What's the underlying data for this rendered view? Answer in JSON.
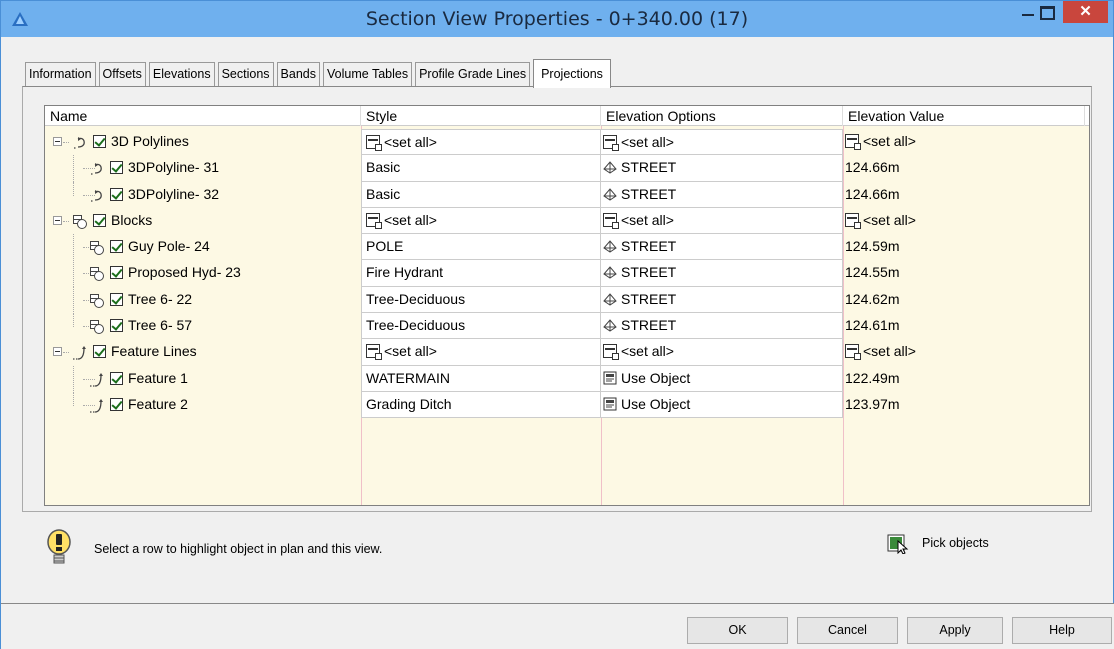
{
  "window": {
    "title": "Section View Properties - 0+340.00 (17)",
    "close_glyph": "✕"
  },
  "tabs": [
    {
      "label": "Information"
    },
    {
      "label": "Offsets"
    },
    {
      "label": "Elevations"
    },
    {
      "label": "Sections"
    },
    {
      "label": "Bands"
    },
    {
      "label": "Volume Tables"
    },
    {
      "label": "Profile Grade Lines"
    },
    {
      "label": "Projections",
      "active": true
    }
  ],
  "grid": {
    "columns": [
      "Name",
      "Style",
      "Elevation Options",
      "Elevation Value"
    ],
    "rows": [
      {
        "level": 0,
        "icon": "polyline-icon",
        "name": "3D Polylines",
        "style": "<set all>",
        "style_icon": "set-all-icon",
        "elev_option": "<set all>",
        "elev_icon": "set-all-icon",
        "elev_value": "<set all>",
        "value_icon": "set-all-icon",
        "checked": true
      },
      {
        "level": 1,
        "icon": "polyline-icon",
        "name": "3DPolyline- 31",
        "style": "Basic",
        "elev_option": "STREET",
        "elev_icon": "surface-icon",
        "elev_value": "124.66m",
        "checked": true
      },
      {
        "level": 1,
        "icon": "polyline-icon",
        "name": "3DPolyline- 32",
        "style": "Basic",
        "elev_option": "STREET",
        "elev_icon": "surface-icon",
        "elev_value": "124.66m",
        "checked": true
      },
      {
        "level": 0,
        "icon": "block-icon",
        "name": "Blocks",
        "style": "<set all>",
        "style_icon": "set-all-icon",
        "elev_option": "<set all>",
        "elev_icon": "set-all-icon",
        "elev_value": "<set all>",
        "value_icon": "set-all-icon",
        "checked": true
      },
      {
        "level": 1,
        "icon": "block-icon",
        "name": "Guy Pole- 24",
        "style": "POLE",
        "elev_option": "STREET",
        "elev_icon": "surface-icon",
        "elev_value": "124.59m",
        "checked": true
      },
      {
        "level": 1,
        "icon": "block-icon",
        "name": "Proposed Hyd- 23",
        "style": "Fire Hydrant",
        "elev_option": "STREET",
        "elev_icon": "surface-icon",
        "elev_value": "124.55m",
        "checked": true
      },
      {
        "level": 1,
        "icon": "block-icon",
        "name": "Tree 6- 22",
        "style": "Tree-Deciduous",
        "elev_option": "STREET",
        "elev_icon": "surface-icon",
        "elev_value": "124.62m",
        "checked": true
      },
      {
        "level": 1,
        "icon": "block-icon",
        "name": "Tree 6- 57",
        "style": "Tree-Deciduous",
        "elev_option": "STREET",
        "elev_icon": "surface-icon",
        "elev_value": "124.61m",
        "checked": true
      },
      {
        "level": 0,
        "icon": "feature-line-icon",
        "name": "Feature Lines",
        "style": "<set all>",
        "style_icon": "set-all-icon",
        "elev_option": "<set all>",
        "elev_icon": "set-all-icon",
        "elev_value": "<set all>",
        "value_icon": "set-all-icon",
        "checked": true
      },
      {
        "level": 1,
        "icon": "feature-line-icon",
        "name": "Feature  1",
        "style": "WATERMAIN",
        "elev_option": "Use Object",
        "elev_icon": "use-object-icon",
        "elev_value": "122.49m",
        "checked": true
      },
      {
        "level": 1,
        "icon": "feature-line-icon",
        "name": "Feature  2",
        "style": "Grading Ditch",
        "elev_option": "Use Object",
        "elev_icon": "use-object-icon",
        "elev_value": "123.97m",
        "checked": true
      }
    ]
  },
  "hint": {
    "icon": "lightbulb-icon",
    "text": "Select a row to highlight object in plan and this view."
  },
  "pick": {
    "icon": "pick-objects-icon",
    "label": "Pick objects"
  },
  "buttons": {
    "ok": "OK",
    "cancel": "Cancel",
    "apply": "Apply",
    "help": "Help"
  },
  "colors": {
    "titlebar": "#6fb0ee",
    "grid_background": "#fdf9e4",
    "close_button": "#c9463d"
  }
}
